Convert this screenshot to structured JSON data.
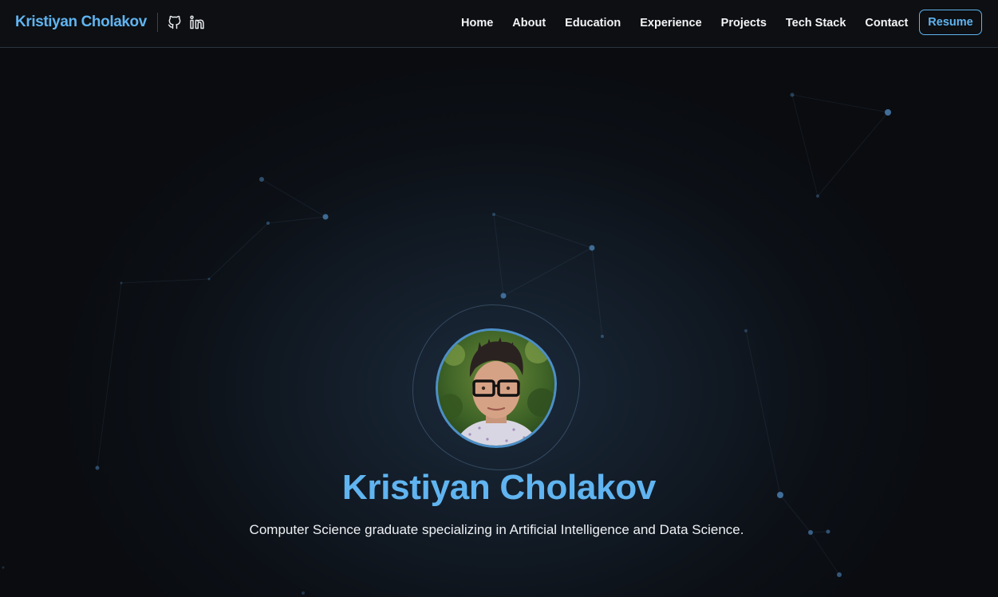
{
  "theme": {
    "accent": "#60b4f0",
    "nav_text": "#f2f4f6",
    "background": "#0a0c0f"
  },
  "navbar": {
    "brand": "Kristiyan Cholakov",
    "social": [
      {
        "icon": "github-icon"
      },
      {
        "icon": "linkedin-icon"
      }
    ],
    "links": [
      {
        "label": "Home"
      },
      {
        "label": "About"
      },
      {
        "label": "Education"
      },
      {
        "label": "Experience"
      },
      {
        "label": "Projects"
      },
      {
        "label": "Tech Stack"
      },
      {
        "label": "Contact"
      }
    ],
    "resume_label": "Resume"
  },
  "hero": {
    "name": "Kristiyan Cholakov",
    "tagline": "Computer Science graduate specializing in Artificial Intelligence and Data Science."
  }
}
